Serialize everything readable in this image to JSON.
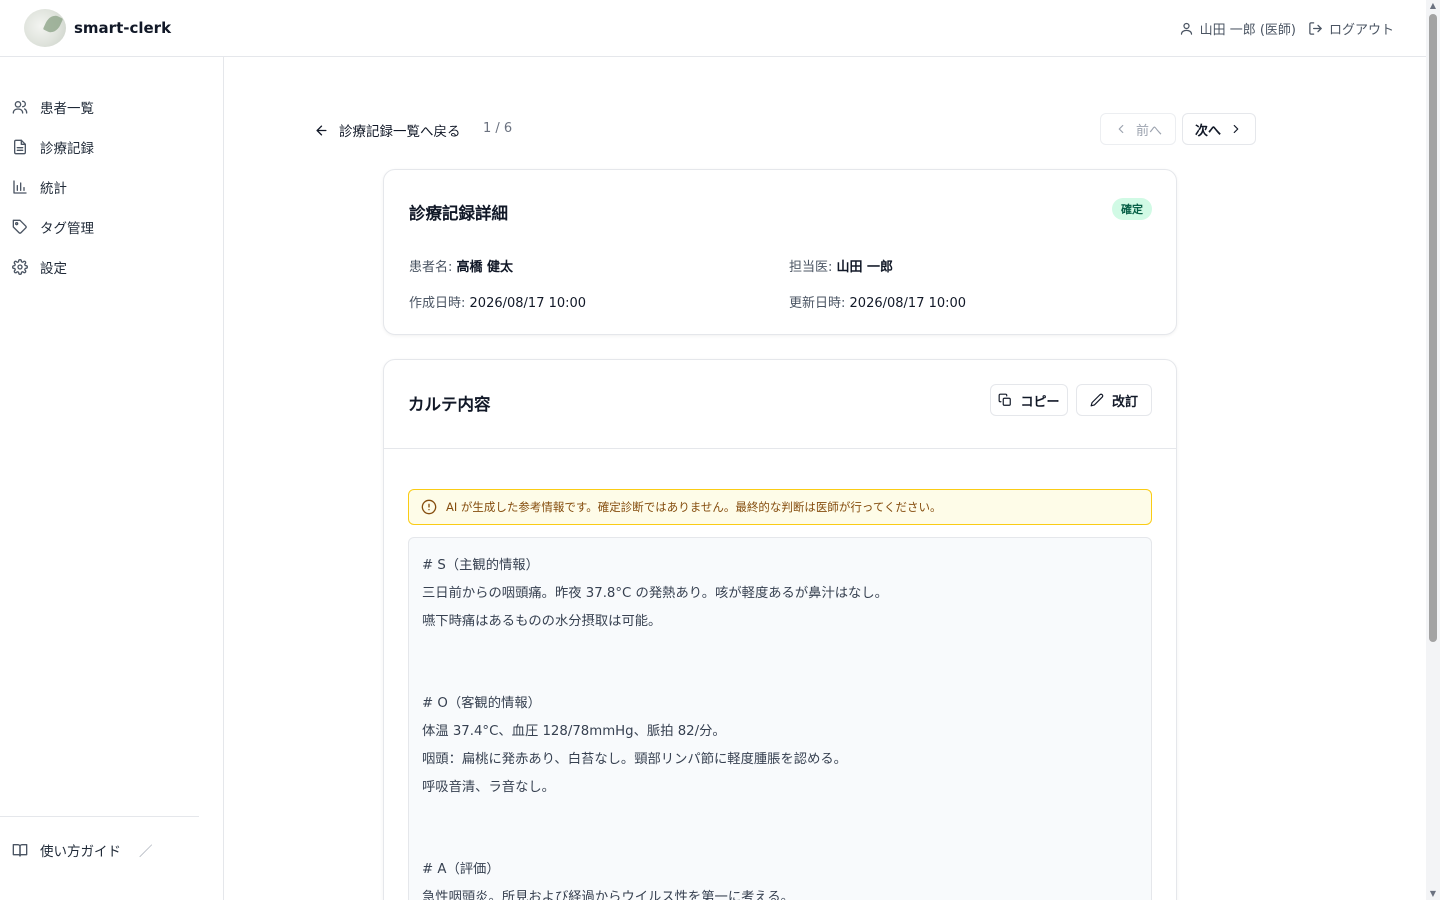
{
  "header": {
    "app_name": "smart-clerk",
    "user_label": "山田 一郎 (医師)",
    "logout_label": "ログアウト"
  },
  "sidebar": {
    "items": [
      {
        "label": "患者一覧",
        "icon": "users-icon"
      },
      {
        "label": "診療記録",
        "icon": "document-icon"
      },
      {
        "label": "統計",
        "icon": "bar-chart-icon"
      },
      {
        "label": "タグ管理",
        "icon": "tag-icon"
      },
      {
        "label": "設定",
        "icon": "gear-icon"
      }
    ],
    "guide_label": "使い方ガイド",
    "guide_extra": "／"
  },
  "nav": {
    "back_label": "診療記録一覧へ戻る",
    "position": "1 / 6",
    "prev_label": "前へ",
    "next_label": "次へ"
  },
  "detail": {
    "title": "診療記録詳細",
    "status": "確定",
    "patient_label": "患者名:",
    "patient_name": "高橋 健太",
    "doctor_label": "担当医:",
    "doctor_name": "山田 一郎",
    "created_label": "作成日時:",
    "created_at": "2026/08/17 10:00",
    "updated_label": "更新日時:",
    "updated_at": "2026/08/17 10:00"
  },
  "karte": {
    "title": "カルテ内容",
    "copy_label": "コピー",
    "revise_label": "改訂",
    "notice": "AI が生成した参考情報です。確定診断ではありません。最終的な判断は医師が行ってください。",
    "lines": [
      "# S（主観的情報）",
      "三日前からの咽頭痛。昨夜 37.8°C の発熱あり。咳が軽度あるが鼻汁はなし。",
      "嚥下時痛はあるものの水分摂取は可能。",
      "# O（客観的情報）",
      "体温 37.4°C、血圧 128/78mmHg、脈拍 82/分。",
      "咽頭：扁桃に発赤あり、白苔なし。頸部リンパ節に軽度腫脹を認める。",
      "呼吸音清、ラ音なし。",
      "# A（評価）",
      "急性咽頭炎。所見および経過からウイルス性を第一に考える。"
    ]
  },
  "colors": {
    "status_bg": "#d1fae5",
    "status_text": "#065f46",
    "notice_border": "#facc15",
    "notice_bg": "#fefce8"
  }
}
